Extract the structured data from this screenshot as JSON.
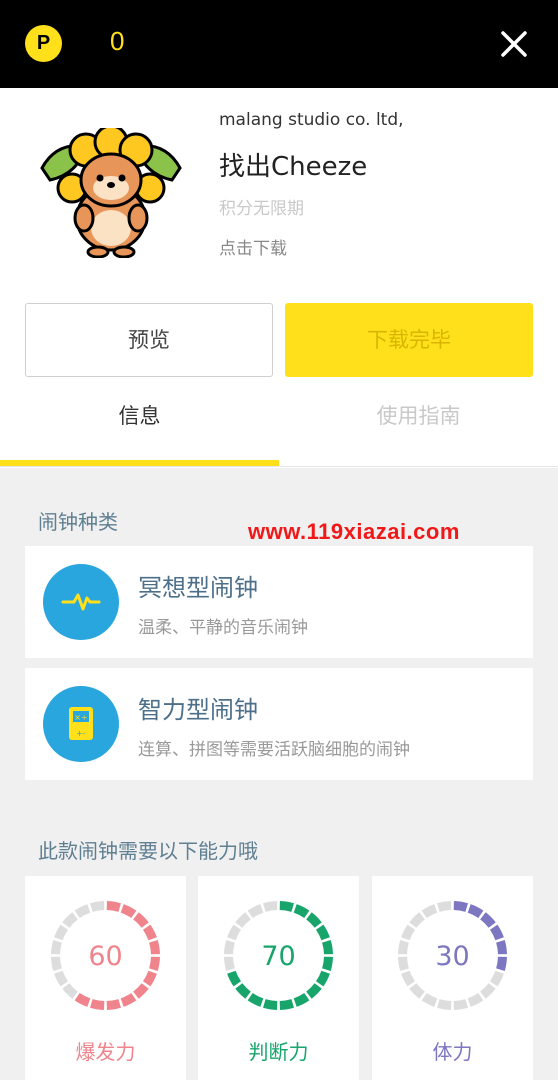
{
  "topbar": {
    "coin_label": "P",
    "points": "0"
  },
  "app": {
    "developer": "malang studio co. ltd,",
    "title": "找出Cheeze",
    "validity": "积分无限期",
    "download_hint": "点击下载"
  },
  "buttons": {
    "preview": "预览",
    "download": "下载完毕"
  },
  "tabs": [
    {
      "label": "信息",
      "active": true
    },
    {
      "label": "使用指南",
      "active": false
    }
  ],
  "watermark": "www.119xiazai.com",
  "alarm_section": {
    "title": "闹钟种类",
    "items": [
      {
        "name": "冥想型闹钟",
        "desc": "温柔、平静的音乐闹钟",
        "icon": "heartbeat-icon"
      },
      {
        "name": "智力型闹钟",
        "desc": "连算、拼图等需要活跃脑细胞的闹钟",
        "icon": "calculator-icon"
      }
    ]
  },
  "ability_section": {
    "title": "此款闹钟需要以下能力哦",
    "items": [
      {
        "value": 60,
        "label": "爆发力",
        "color": "#f0848c"
      },
      {
        "value": 70,
        "label": "判断力",
        "color": "#17a56b"
      },
      {
        "value": 30,
        "label": "体力",
        "color": "#7d76c0"
      }
    ]
  },
  "colors": {
    "accent_yellow": "#ffe01b",
    "alarm_icon_blue": "#2aa6df",
    "section_title": "#5f7f92",
    "ring_track": "#dddddd"
  }
}
